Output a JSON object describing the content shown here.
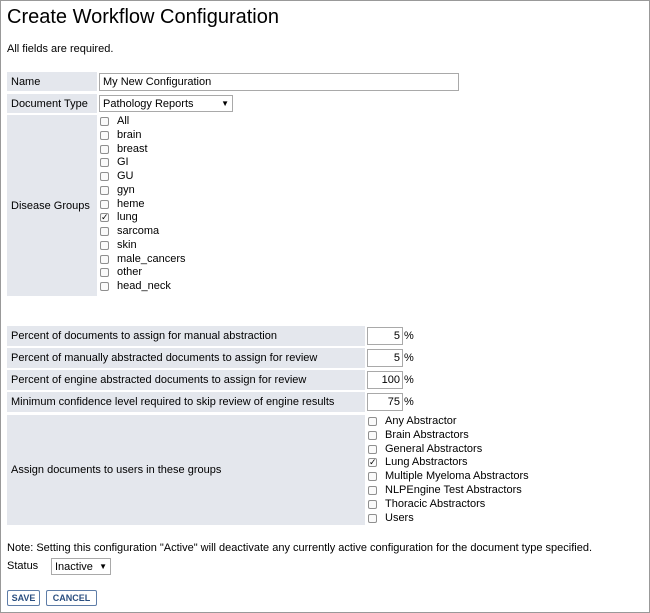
{
  "page": {
    "title": "Create Workflow Configuration",
    "required_note": "All fields are required."
  },
  "form": {
    "name_label": "Name",
    "name_value": "My New Configuration",
    "doc_type_label": "Document Type",
    "doc_type_value": "Pathology Reports",
    "disease_groups_label": "Disease Groups",
    "disease_groups": [
      {
        "label": "All",
        "checked": false
      },
      {
        "label": "brain",
        "checked": false
      },
      {
        "label": "breast",
        "checked": false
      },
      {
        "label": "GI",
        "checked": false
      },
      {
        "label": "GU",
        "checked": false
      },
      {
        "label": "gyn",
        "checked": false
      },
      {
        "label": "heme",
        "checked": false
      },
      {
        "label": "lung",
        "checked": true
      },
      {
        "label": "sarcoma",
        "checked": false
      },
      {
        "label": "skin",
        "checked": false
      },
      {
        "label": "male_cancers",
        "checked": false
      },
      {
        "label": "other",
        "checked": false
      },
      {
        "label": "head_neck",
        "checked": false
      }
    ],
    "percent_fields": [
      {
        "label": "Percent of documents to assign for manual abstraction",
        "value": "5",
        "unit": "%"
      },
      {
        "label": "Percent of manually abstracted documents to assign for review",
        "value": "5",
        "unit": "%"
      },
      {
        "label": "Percent of engine abstracted documents to assign for review",
        "value": "100",
        "unit": "%"
      },
      {
        "label": "Minimum confidence level required to skip review of engine results",
        "value": "75",
        "unit": "%"
      }
    ],
    "assign_groups_label": "Assign documents to users in these groups",
    "assign_groups": [
      {
        "label": "Any Abstractor",
        "checked": false
      },
      {
        "label": "Brain Abstractors",
        "checked": false
      },
      {
        "label": "General Abstractors",
        "checked": false
      },
      {
        "label": "Lung Abstractors",
        "checked": true
      },
      {
        "label": "Multiple Myeloma Abstractors",
        "checked": false
      },
      {
        "label": "NLPEngine Test Abstractors",
        "checked": false
      },
      {
        "label": "Thoracic Abstractors",
        "checked": false
      },
      {
        "label": "Users",
        "checked": false
      }
    ],
    "active_note": "Note: Setting this configuration \"Active\" will deactivate any currently active configuration for the document type specified.",
    "status_label": "Status",
    "status_value": "Inactive"
  },
  "buttons": {
    "save": "SAVE",
    "cancel": "CANCEL"
  }
}
